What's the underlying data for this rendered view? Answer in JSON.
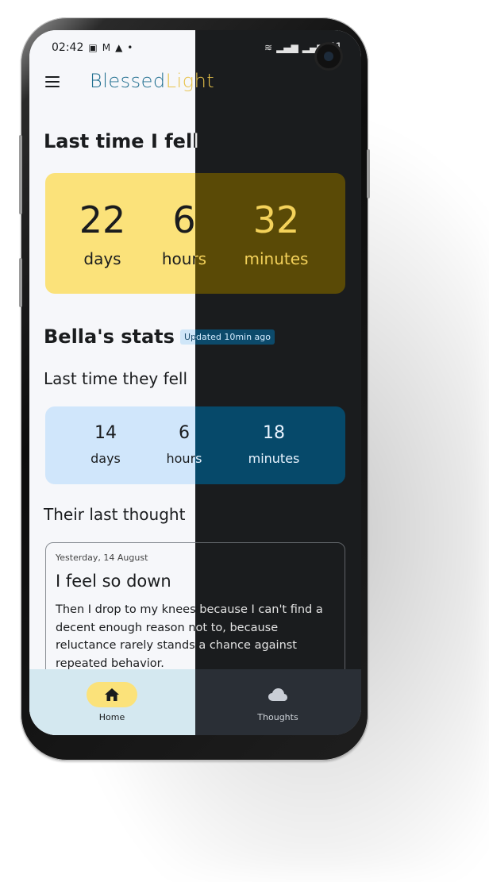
{
  "status_bar": {
    "time": "02:42",
    "battery": "51"
  },
  "app": {
    "brand_part1": "Blessed",
    "brand_part2": "Light"
  },
  "my_fall": {
    "heading": "Last time I fell",
    "days_value": "22",
    "days_label": "days",
    "hours_value": "6",
    "hours_label": "hours",
    "minutes_value": "32",
    "minutes_label": "minutes"
  },
  "partner_stats": {
    "heading": "Bella's stats",
    "updated_badge": "Updated 10min ago",
    "subheading": "Last time they fell",
    "days_value": "14",
    "days_label": "days",
    "hours_value": "6",
    "hours_label": "hours",
    "minutes_value": "18",
    "minutes_label": "minutes"
  },
  "last_thought": {
    "heading": "Their last thought",
    "date": "Yesterday, 14 August",
    "title": "I feel so down",
    "body": "Then I drop to my knees because I can't find a decent enough reason not to, because reluctance rarely stands a chance against repeated behavior."
  },
  "navbar": {
    "home_label": "Home",
    "home_icon": "home-icon",
    "thoughts_label": "Thoughts",
    "thoughts_icon": "cloud-icon"
  },
  "colors": {
    "brand_blue": "#1f6e8f",
    "brand_yellow": "#e7c24a",
    "card_yellow_light": "#fbe27a",
    "card_yellow_dark": "#5a4a06",
    "card_blue_light": "#d0e6fb",
    "card_blue_dark": "#06496a"
  }
}
